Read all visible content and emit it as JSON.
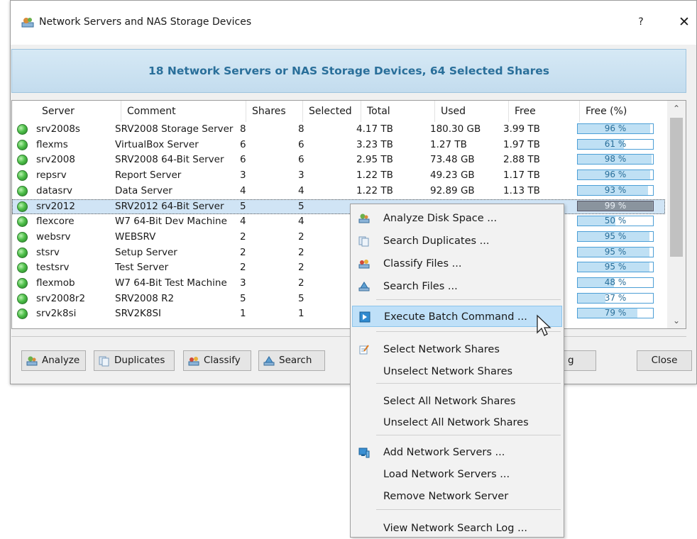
{
  "window": {
    "title": "Network Servers and NAS Storage Devices",
    "help_label": "?",
    "close_label": "✕",
    "banner": "18 Network Servers or NAS Storage Devices, 64 Selected Shares"
  },
  "table": {
    "columns": [
      "Server",
      "Comment",
      "Shares",
      "Selected",
      "Total",
      "Used",
      "Free",
      "Free (%)"
    ],
    "rows": [
      {
        "server": "srv2008s",
        "comment": "SRV2008 Storage Server",
        "shares": "8",
        "selected": "8",
        "total": "4.17 TB",
        "used": "180.30 GB",
        "free": "3.99 TB",
        "pct_label": "96 %",
        "pct": 96
      },
      {
        "server": "flexms",
        "comment": "VirtualBox Server",
        "shares": "6",
        "selected": "6",
        "total": "3.23 TB",
        "used": "1.27 TB",
        "free": "1.97 TB",
        "pct_label": "61 %",
        "pct": 61
      },
      {
        "server": "srv2008",
        "comment": "SRV2008 64-Bit Server",
        "shares": "6",
        "selected": "6",
        "total": "2.95 TB",
        "used": "73.48 GB",
        "free": "2.88 TB",
        "pct_label": "98 %",
        "pct": 98
      },
      {
        "server": "repsrv",
        "comment": "Report Server",
        "shares": "3",
        "selected": "3",
        "total": "1.22 TB",
        "used": "49.23 GB",
        "free": "1.17 TB",
        "pct_label": "96 %",
        "pct": 96
      },
      {
        "server": "datasrv",
        "comment": "Data Server",
        "shares": "4",
        "selected": "4",
        "total": "1.22 TB",
        "used": "92.89 GB",
        "free": "1.13 TB",
        "pct_label": "93 %",
        "pct": 93
      },
      {
        "server": "srv2012",
        "comment": "SRV2012 64-Bit Server",
        "shares": "5",
        "selected": "5",
        "total": "",
        "used": "",
        "free": "",
        "pct_label": "99 %",
        "pct": 99
      },
      {
        "server": "flexcore",
        "comment": "W7 64-Bit Dev Machine",
        "shares": "4",
        "selected": "4",
        "total": "",
        "used": "",
        "free": "",
        "pct_label": "50 %",
        "pct": 50
      },
      {
        "server": "websrv",
        "comment": "WEBSRV",
        "shares": "2",
        "selected": "2",
        "total": "",
        "used": "",
        "free": "",
        "pct_label": "95 %",
        "pct": 95
      },
      {
        "server": "stsrv",
        "comment": "Setup Server",
        "shares": "2",
        "selected": "2",
        "total": "",
        "used": "",
        "free": "",
        "pct_label": "95 %",
        "pct": 95
      },
      {
        "server": "testsrv",
        "comment": "Test Server",
        "shares": "2",
        "selected": "2",
        "total": "",
        "used": "",
        "free": "",
        "pct_label": "95 %",
        "pct": 95
      },
      {
        "server": "flexmob",
        "comment": "W7 64-Bit Test Machine",
        "shares": "3",
        "selected": "2",
        "total": "",
        "used": "",
        "free": "",
        "pct_label": "48 %",
        "pct": 48
      },
      {
        "server": "srv2008r2",
        "comment": "SRV2008 R2",
        "shares": "5",
        "selected": "5",
        "total": "",
        "used": "",
        "free": "",
        "pct_label": "37 %",
        "pct": 37
      },
      {
        "server": "srv2k8si",
        "comment": "SRV2K8SI",
        "shares": "1",
        "selected": "1",
        "total": "",
        "used": "",
        "free": "",
        "pct_label": "79 %",
        "pct": 79
      }
    ],
    "selected_row_index": 5
  },
  "buttons": {
    "analyze": "Analyze",
    "duplicates": "Duplicates",
    "classify": "Classify",
    "search": "Search",
    "hidden_log_fragment": "g",
    "close": "Close"
  },
  "context_menu": {
    "items": [
      {
        "label": "Analyze Disk Space ...",
        "icon": "analyze-icon"
      },
      {
        "label": "Search Duplicates ...",
        "icon": "duplicates-icon"
      },
      {
        "label": "Classify Files ...",
        "icon": "classify-icon"
      },
      {
        "label": "Search Files ...",
        "icon": "search-files-icon"
      },
      {
        "label": "Execute Batch Command ...",
        "icon": "batch-command-icon",
        "highlighted": true
      },
      {
        "label": "Select Network Shares",
        "icon": "select-shares-icon"
      },
      {
        "label": "Unselect Network Shares",
        "icon": ""
      },
      {
        "label": "Select All Network Shares",
        "icon": ""
      },
      {
        "label": "Unselect All Network Shares",
        "icon": ""
      },
      {
        "label": "Add Network Servers ...",
        "icon": "add-servers-icon"
      },
      {
        "label": "Load Network Servers ...",
        "icon": ""
      },
      {
        "label": "Remove Network Server",
        "icon": ""
      },
      {
        "label": "View Network Search Log ...",
        "icon": ""
      }
    ]
  },
  "colors": {
    "banner_text": "#2a6f9a",
    "progress_border": "#4c9fd6",
    "status_ok": "#4fc04a",
    "menu_highlight": "#bfe0f8"
  }
}
